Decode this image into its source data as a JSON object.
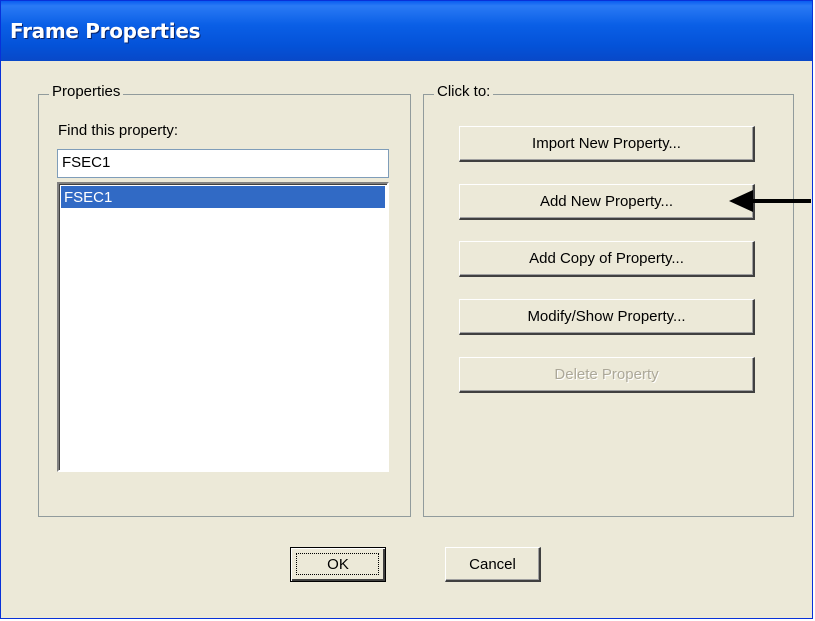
{
  "window": {
    "title": "Frame Properties"
  },
  "properties_group": {
    "legend": "Properties",
    "find_label": "Find this property:",
    "find_value": "FSEC1",
    "list_items": [
      "FSEC1"
    ],
    "selected_item": "FSEC1"
  },
  "actions_group": {
    "legend": "Click to:",
    "buttons": {
      "import": "Import New Property...",
      "add_new": "Add New Property...",
      "add_copy": "Add Copy of Property...",
      "modify_show": "Modify/Show Property...",
      "delete": "Delete Property"
    },
    "delete_enabled": false
  },
  "footer": {
    "ok_label": "OK",
    "cancel_label": "Cancel"
  },
  "colors": {
    "titlebar": "#0a5fe6",
    "dialog_bg": "#ece9d8",
    "selection": "#316ac5",
    "disabled_text": "#aca899"
  },
  "annotation": {
    "icon": "left-arrow-icon"
  }
}
